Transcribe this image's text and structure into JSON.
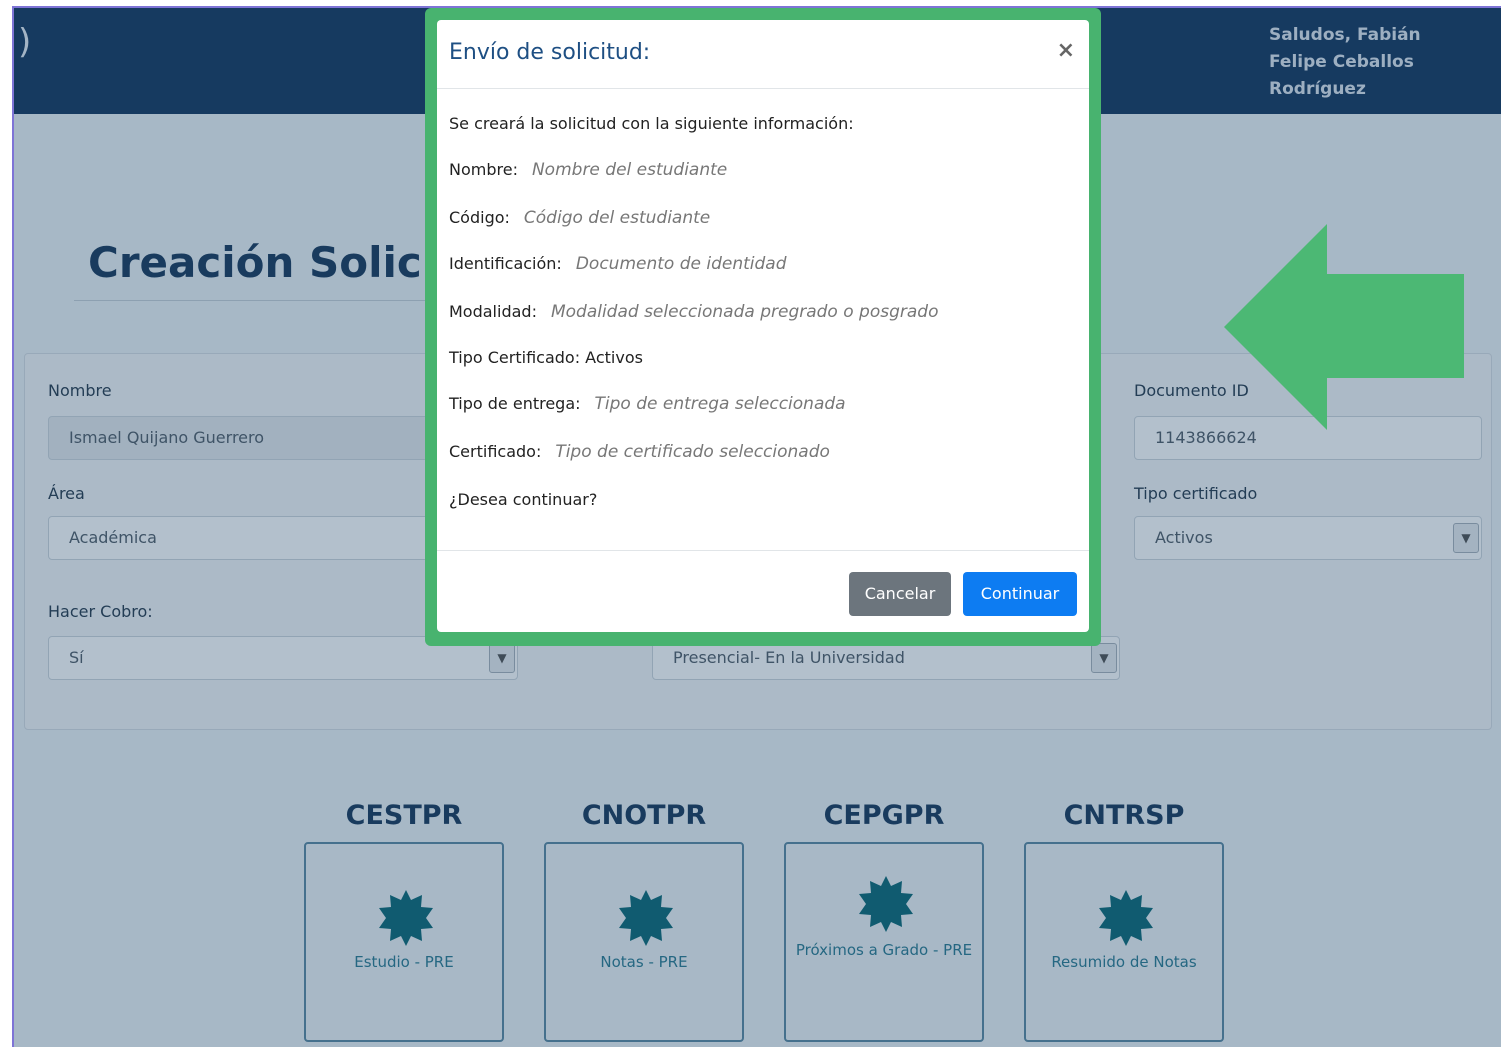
{
  "header": {
    "greeting": "Saludos, Fabián Felipe Ceballos Rodríguez"
  },
  "page": {
    "title": "Creación Solicitud"
  },
  "form": {
    "nombre_label": "Nombre",
    "nombre_value": "Ismael Quijano Guerrero",
    "documento_label": "Documento ID",
    "documento_value": "1143866624",
    "area_label": "Área",
    "area_value": "Académica",
    "tipo_cert_label": "Tipo certificado",
    "tipo_cert_value": "Activos",
    "cobro_label": "Hacer Cobro:",
    "cobro_value": "Sí",
    "entrega_value": "Presencial- En la Universidad"
  },
  "cards": [
    {
      "code": "CESTPR",
      "label": "Estudio - PRE"
    },
    {
      "code": "CNOTPR",
      "label": "Notas - PRE"
    },
    {
      "code": "CEPGPR",
      "label": "Próximos a Grado - PRE"
    },
    {
      "code": "CNTRSP",
      "label": "Resumido de Notas"
    }
  ],
  "modal": {
    "title": "Envío de solicitud:",
    "close": "×",
    "intro": "Se creará la solicitud con la siguiente información:",
    "rows": [
      {
        "label": "Nombre:",
        "value": "Nombre del estudiante"
      },
      {
        "label": "Código:",
        "value": "Código del estudiante"
      },
      {
        "label": "Identificación:",
        "value": "Documento de identidad"
      },
      {
        "label": "Modalidad:",
        "value": "Modalidad seleccionada pregrado o posgrado"
      },
      {
        "label": "Tipo Certificado: Activos",
        "value": ""
      },
      {
        "label": "Tipo de entrega:",
        "value": "Tipo de entrega seleccionada"
      },
      {
        "label": "Certificado:",
        "value": "Tipo de certificado seleccionado"
      }
    ],
    "question": "¿Desea continuar?",
    "cancel_label": "Cancelar",
    "continue_label": "Continuar"
  },
  "colors": {
    "header": "#183a61",
    "highlight": "#48b36f",
    "primary_button": "#0d7cf2",
    "secondary_button": "#6c757d"
  }
}
